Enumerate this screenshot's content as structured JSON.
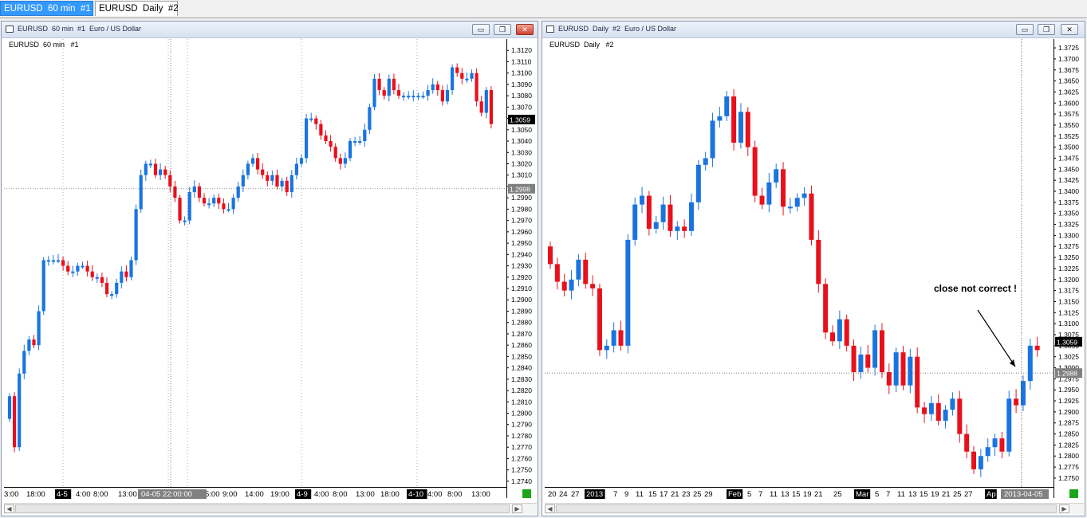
{
  "tabs": [
    {
      "label": "EURUSD  60 min  #1",
      "active": true
    },
    {
      "label": "EURUSD  Daily  #2",
      "active": false
    }
  ],
  "colors": {
    "bull": "#1a74e0",
    "bear": "#e8101c",
    "grid": "#7a7a7a",
    "crosshair": "#555555",
    "price_box": "#000000",
    "crosshair_box": "#808080"
  },
  "icons": [
    "window-icon",
    "minimize-icon",
    "maximize-icon",
    "close-icon",
    "scroll-left-icon",
    "scroll-right-icon"
  ],
  "left_window": {
    "title": "EURUSD  60 min  #1  Euro / US Dollar",
    "chart_label": "EURUSD  60 min   #1",
    "current_price": "1.3059",
    "crosshair_price": "1.2998",
    "crosshair_time": "04-05  22:00:00",
    "x_labels": [
      "3:00",
      "18:00",
      "4-5",
      "4:00",
      "8:00",
      "13:00",
      "",
      "5:00",
      "9:00",
      "14:00",
      "19:00",
      "4-9",
      "4:00",
      "8:00",
      "13:00",
      "18:00",
      "4-10",
      "4:00",
      "8:00",
      "13:00"
    ]
  },
  "right_window": {
    "title": "EURUSD  Daily  #2  Euro / US Dollar",
    "chart_label": "EURUSD  Daily   #2",
    "current_price": "1.3059",
    "crosshair_price": "1.2988",
    "crosshair_time": "2013-04-05",
    "annotation": "close not correct !",
    "x_labels": [
      "20",
      "24",
      "27",
      "2013",
      "7",
      "9",
      "11",
      "15",
      "17",
      "21",
      "23",
      "25",
      "29",
      "Feb",
      "5",
      "7",
      "11",
      "13",
      "15",
      "19",
      "21",
      "25",
      "Mar",
      "5",
      "7",
      "11",
      "13",
      "15",
      "19",
      "21",
      "25",
      "27",
      "Ap"
    ]
  },
  "chart_data": [
    {
      "type": "candlestick",
      "title": "EURUSD  60 min   #1",
      "ylim": [
        1.2735,
        1.313
      ],
      "y_ticks": [
        "1.3120",
        "1.3110",
        "1.3100",
        "1.3090",
        "1.3080",
        "1.3070",
        "1.3060",
        "1.3050",
        "1.3040",
        "1.3030",
        "1.3020",
        "1.3010",
        "1.3000",
        "1.2990",
        "1.2980",
        "1.2970",
        "1.2960",
        "1.2950",
        "1.2940",
        "1.2930",
        "1.2920",
        "1.2910",
        "1.2900",
        "1.2890",
        "1.2880",
        "1.2870",
        "1.2860",
        "1.2850",
        "1.2840",
        "1.2830",
        "1.2820",
        "1.2810",
        "1.2800",
        "1.2790",
        "1.2780",
        "1.2770",
        "1.2760",
        "1.2750",
        "1.2740"
      ],
      "closes": [
        1.2815,
        1.277,
        1.2835,
        1.2855,
        1.2865,
        1.286,
        1.289,
        1.2935,
        1.2935,
        1.2935,
        1.2935,
        1.293,
        1.2925,
        1.2925,
        1.293,
        1.293,
        1.2925,
        1.292,
        1.292,
        1.2915,
        1.2905,
        1.2905,
        1.2915,
        1.2925,
        1.292,
        1.2935,
        1.298,
        1.301,
        1.302,
        1.302,
        1.301,
        1.3015,
        1.301,
        1.3,
        1.299,
        1.297,
        1.297,
        1.2995,
        1.3,
        1.299,
        1.2985,
        1.2985,
        1.299,
        1.2985,
        1.298,
        1.298,
        1.299,
        1.3,
        1.301,
        1.302,
        1.3025,
        1.3015,
        1.301,
        1.3005,
        1.301,
        1.3,
        1.3005,
        1.2995,
        1.301,
        1.302,
        1.3025,
        1.306,
        1.306,
        1.3055,
        1.3045,
        1.304,
        1.3035,
        1.3025,
        1.302,
        1.3025,
        1.304,
        1.304,
        1.304,
        1.305,
        1.307,
        1.3095,
        1.3085,
        1.308,
        1.3095,
        1.3085,
        1.308,
        1.308,
        1.308,
        1.308,
        1.308,
        1.308,
        1.3085,
        1.309,
        1.3085,
        1.3075,
        1.3085,
        1.3105,
        1.31,
        1.3095,
        1.3095,
        1.31,
        1.3075,
        1.3065,
        1.3085,
        1.3055
      ]
    },
    {
      "type": "candlestick",
      "title": "EURUSD  Daily   #2",
      "ylim": [
        1.273,
        1.3745
      ],
      "y_ticks": [
        "1.3725",
        "1.3700",
        "1.3675",
        "1.3650",
        "1.3625",
        "1.3600",
        "1.3575",
        "1.3550",
        "1.3525",
        "1.3500",
        "1.3475",
        "1.3450",
        "1.3425",
        "1.3400",
        "1.3375",
        "1.3350",
        "1.3325",
        "1.3300",
        "1.3275",
        "1.3250",
        "1.3225",
        "1.3200",
        "1.3175",
        "1.3150",
        "1.3125",
        "1.3100",
        "1.3075",
        "1.3050",
        "1.3025",
        "1.3000",
        "1.2975",
        "1.2950",
        "1.2925",
        "1.2900",
        "1.2875",
        "1.2850",
        "1.2825",
        "1.2800",
        "1.2775",
        "1.2750"
      ],
      "closes": [
        1.3235,
        1.3195,
        1.3175,
        1.32,
        1.3245,
        1.319,
        1.318,
        1.304,
        1.305,
        1.3085,
        1.305,
        1.329,
        1.337,
        1.339,
        1.3315,
        1.333,
        1.337,
        1.331,
        1.332,
        1.331,
        1.3375,
        1.346,
        1.3475,
        1.356,
        1.357,
        1.3615,
        1.351,
        1.358,
        1.35,
        1.339,
        1.337,
        1.342,
        1.345,
        1.3365,
        1.3365,
        1.3385,
        1.3395,
        1.329,
        1.319,
        1.308,
        1.306,
        1.311,
        1.305,
        1.299,
        1.303,
        1.3,
        1.3085,
        1.299,
        1.296,
        1.3035,
        1.296,
        1.3025,
        1.291,
        1.2895,
        1.292,
        1.288,
        1.2905,
        1.293,
        1.285,
        1.281,
        1.277,
        1.28,
        1.282,
        1.284,
        1.281,
        1.293,
        1.2915,
        1.297,
        1.305,
        1.304
      ]
    }
  ]
}
